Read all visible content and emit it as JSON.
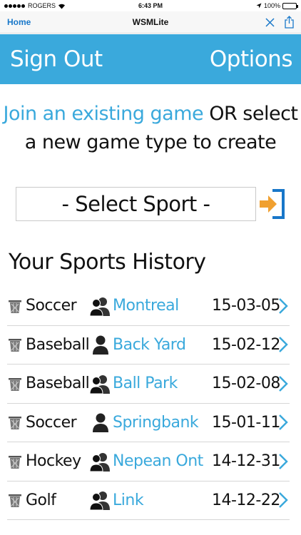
{
  "status_bar": {
    "carrier": "ROGERS",
    "time": "6:43 PM",
    "battery": "100%"
  },
  "nav": {
    "back_label": "Home",
    "title": "WSMLite"
  },
  "header": {
    "sign_out_label": "Sign Out",
    "options_label": "Options"
  },
  "prompt": {
    "link_text": "Join an existing game",
    "rest_line1": " OR select",
    "line2": "a new game type to create"
  },
  "select": {
    "value": "- Select Sport -"
  },
  "history": {
    "title": "Your Sports History",
    "rows": [
      {
        "sport": "Soccer",
        "players": "group",
        "location": "Montreal",
        "date": "15-03-05"
      },
      {
        "sport": "Baseball",
        "players": "single",
        "location": "Back Yard",
        "date": "15-02-12"
      },
      {
        "sport": "Baseball",
        "players": "group",
        "location": "Ball Park",
        "date": "15-02-08"
      },
      {
        "sport": "Soccer",
        "players": "single",
        "location": "Springbank",
        "date": "15-01-11"
      },
      {
        "sport": "Hockey",
        "players": "group",
        "location": "Nepean Ont",
        "date": "14-12-31"
      },
      {
        "sport": "Golf",
        "players": "group",
        "location": "Link",
        "date": "14-12-22"
      }
    ]
  },
  "colors": {
    "accent": "#3aa9dc",
    "nav_link": "#1877c9",
    "enter_arrow": "#f0a030"
  }
}
